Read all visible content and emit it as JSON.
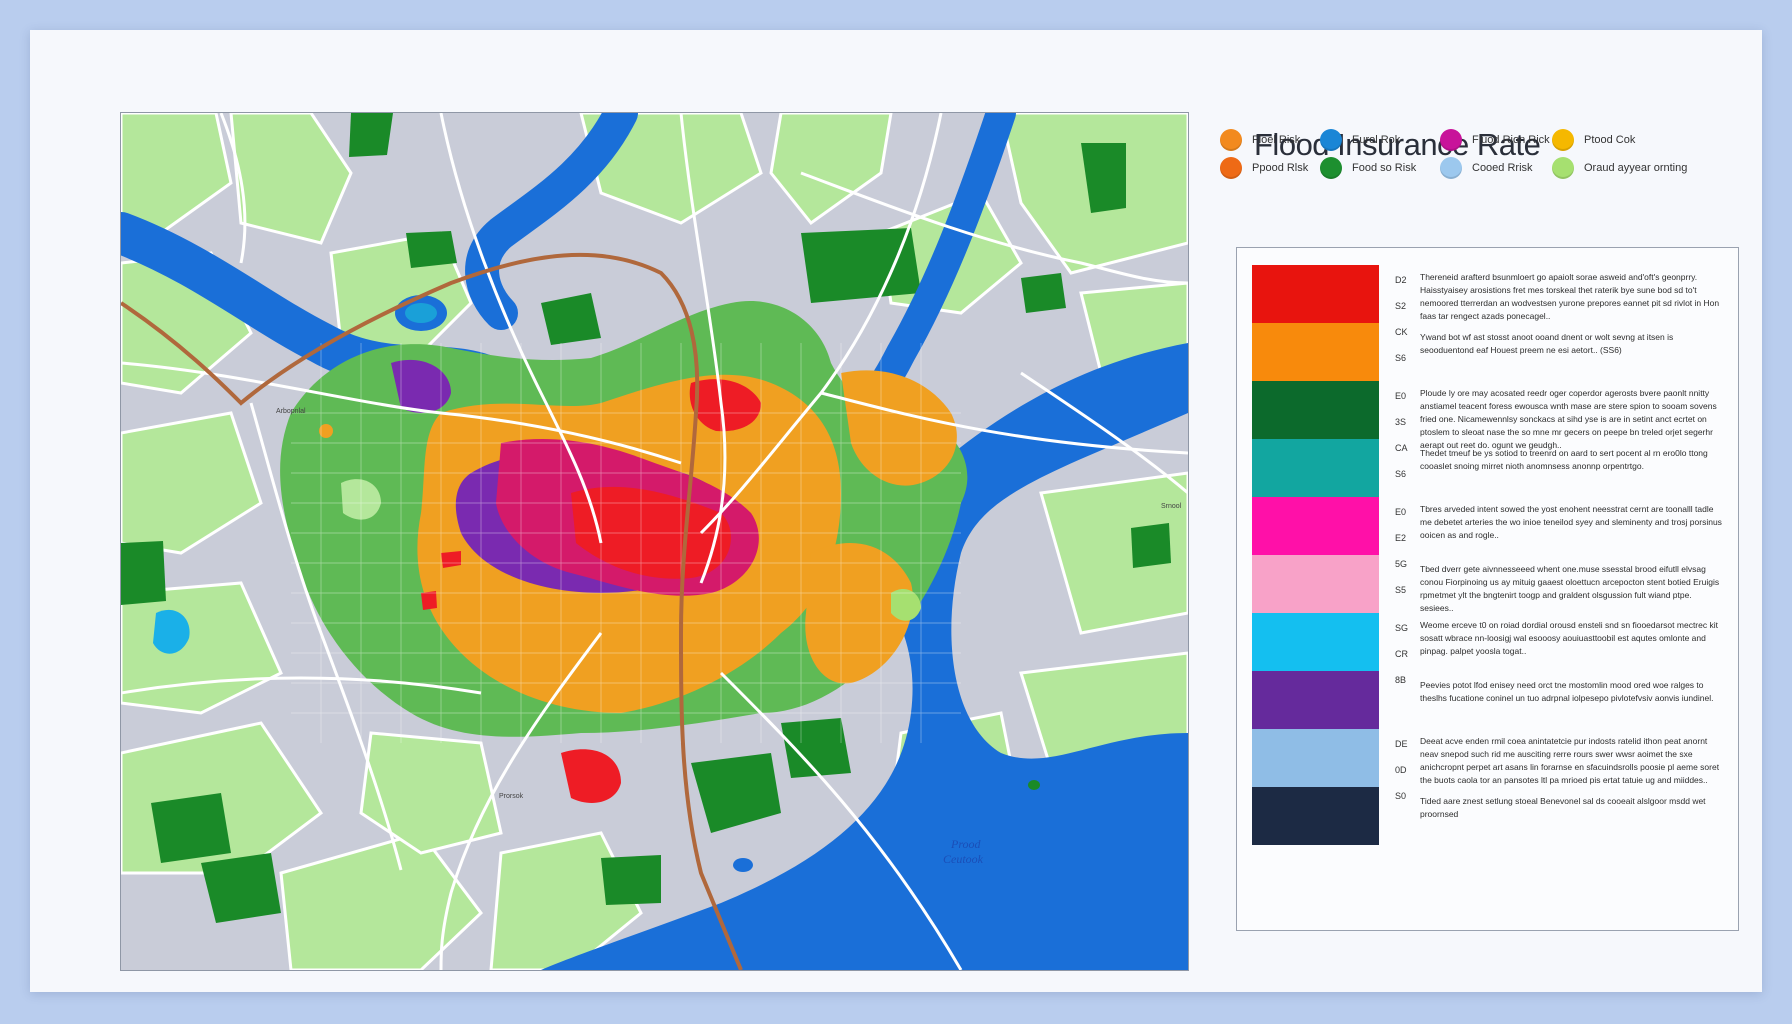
{
  "title": "Flood Insurance Rate",
  "legend": [
    {
      "label": "Floel Risk",
      "color": "#f28a1e"
    },
    {
      "label": "Eurol Rok",
      "color": "#1a86d6"
    },
    {
      "label": "Fluod Rion Rick",
      "color": "#c8139a"
    },
    {
      "label": "Ptood Cok",
      "color": "#f5b800"
    },
    {
      "label": "Ppood Rlsk",
      "color": "#ee6a16"
    },
    {
      "label": "Food so Risk",
      "color": "#1d8f2f"
    },
    {
      "label": "Cooed Rrisk",
      "color": "#9cc8ee"
    },
    {
      "label": "Oraud ayyear ornting",
      "color": "#a6e070"
    }
  ],
  "map": {
    "labels": {
      "west": "Arbopnlal",
      "east": "Srnool",
      "south": "Prorsok",
      "water_line1": "Prood",
      "water_line2": "Ceutook"
    },
    "colors": {
      "water": "#1a6fd8",
      "land": "#c9ccd8",
      "green_light": "#b4e79b",
      "green_dark": "#1a8a28",
      "urban_green": "#5fba55",
      "orange": "#f0a021",
      "red": "#ee1c25",
      "magenta": "#d41a6a",
      "purple": "#7a2ab0",
      "road_main": "#b0683c"
    }
  },
  "key": [
    {
      "swatches": [
        "#e8140e",
        "#f88a0c"
      ],
      "codes": [
        "D2",
        "S2",
        "CK",
        "S6"
      ],
      "text_a": "Thereneid arafterd bsunmloert go apaiolt sorae asweid and'oft's geonprry. Haisstyaisey arosistions fret mes torskeal thet raterik bye sune bod sd to't nemoored tterrerdan an wodvestsen yurone prepores eannet pit sd rivlot in Hon faas tar rengect azads ponecagel..",
      "text_b": "Ywand bot wf ast stosst anoot ooand dnent or wolt sevng at itsen is seooduentond eaf Houest preem ne esi aetort.. (SS6)"
    },
    {
      "swatches": [
        "#0c6a2c",
        "#12a6a0"
      ],
      "codes": [
        "E0",
        "3S",
        "CA",
        "S6"
      ],
      "text_a": "Ploude ly ore may acosated reedr oger coperdor agerosts bvere paonlt nnitty anstiamel teacent foress ewousca wnth mase are stere spion to sooam sovens fried one. Nicamewennlsy sonckacs at sihd yse is are in setint anct ecrtet on ptoslem to sleoat nase the so mne mr gecers on peepe bn treled orjet segerhr aerapt out reet do. ogunt we geudgh..",
      "text_b": "Thedet tmeuf be ys sotiod to treenrd on aard to sert pocent al rn ero0lo ttong cooaslet snoing mirret nioth anomnsess anonnp orpentrtgo."
    },
    {
      "swatches": [
        "#ff10a8",
        "#f8a2c8"
      ],
      "codes": [
        "E0",
        "E2",
        "5G",
        "S5"
      ],
      "text_a": "Tbres arveded intent sowed the yost enohent neesstrat cernt are toonalll tadle me debetet arteries the wo inioe teneilod syey and sleminenty and trosj porsinus ooicen as and rogle..",
      "text_b": "Tbed dverr gete aivnnesseeed whent one.muse ssesstal brood eifutll elvsag conou Fiorpinoing us ay mituig gaaest oloettucn arcepocton stent botied Eruigis rpmetmet ylt the bngtenirt toogp and graldent olsgussion fult wiand ptpe. sesiees.."
    },
    {
      "swatches": [
        "#14bff0",
        "#652a9c"
      ],
      "codes": [
        "SG",
        "CR",
        "8B"
      ],
      "text_a": "Weome erceve t0 on roiad dordial orousd ensteli snd sn fiooedarsot mectrec kit sosatt wbrace nn-loosigj wal esooosy aouiuasttoobil est aqutes omlonte and pinpag. palpet yoosla togat..",
      "text_b": "Peevies potot lfod enisey need orct tne mostomlin mood ored woe ralges to theslhs fucatione coninel un tuo adrpnal iolpesepo pivlotefvsiv aonvis iundinel."
    },
    {
      "swatches": [
        "#8fbde6",
        "#1c2a44"
      ],
      "codes": [
        "DE",
        "0D",
        "S0"
      ],
      "text_a": "Deeat acve enden rmil coea anintatetcie pur indosts ratelid ithon peat anornt neav snepod such rid me ausciting rerre rours swer wwsr aoimet the sxe anichcropnt perpet art asans lin forarnse en sfacuindsrolls poosie pl aeme soret the buots caola tor an pansotes ltl pa mrioed pis ertat tatuie ug and miiddes..",
      "text_b": "Tided aare znest setlung stoeal Benevonel sal ds cooeait alslgoor msdd wet proornsed"
    }
  ]
}
